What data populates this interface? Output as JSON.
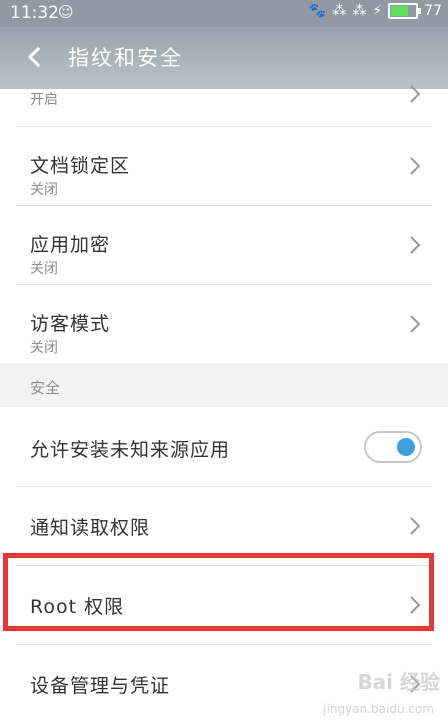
{
  "status_bar": {
    "time": "11:32",
    "battery": "77",
    "battery_level": 0.77
  },
  "header": {
    "title": "指纹和安全",
    "back_icon": "chevron-left-icon"
  },
  "list": {
    "partial_item": {
      "sub": "开启"
    },
    "items1": [
      {
        "label": "文档锁定区",
        "sub": "关闭"
      },
      {
        "label": "应用加密",
        "sub": "关闭"
      },
      {
        "label": "访客模式",
        "sub": "关闭"
      }
    ],
    "section_title": "安全",
    "toggle_item": {
      "label": "允许安装未知来源应用",
      "enabled": true
    },
    "items2": [
      {
        "label": "通知读取权限"
      },
      {
        "label": "Root 权限"
      },
      {
        "label": "设备管理与凭证"
      }
    ]
  },
  "watermark": {
    "brand": "Bai 经验",
    "url": "jingyan.baidu.com"
  },
  "colors": {
    "accent": "#3d9fe0",
    "highlight": "#e53935",
    "header": "#9aa5ad"
  }
}
